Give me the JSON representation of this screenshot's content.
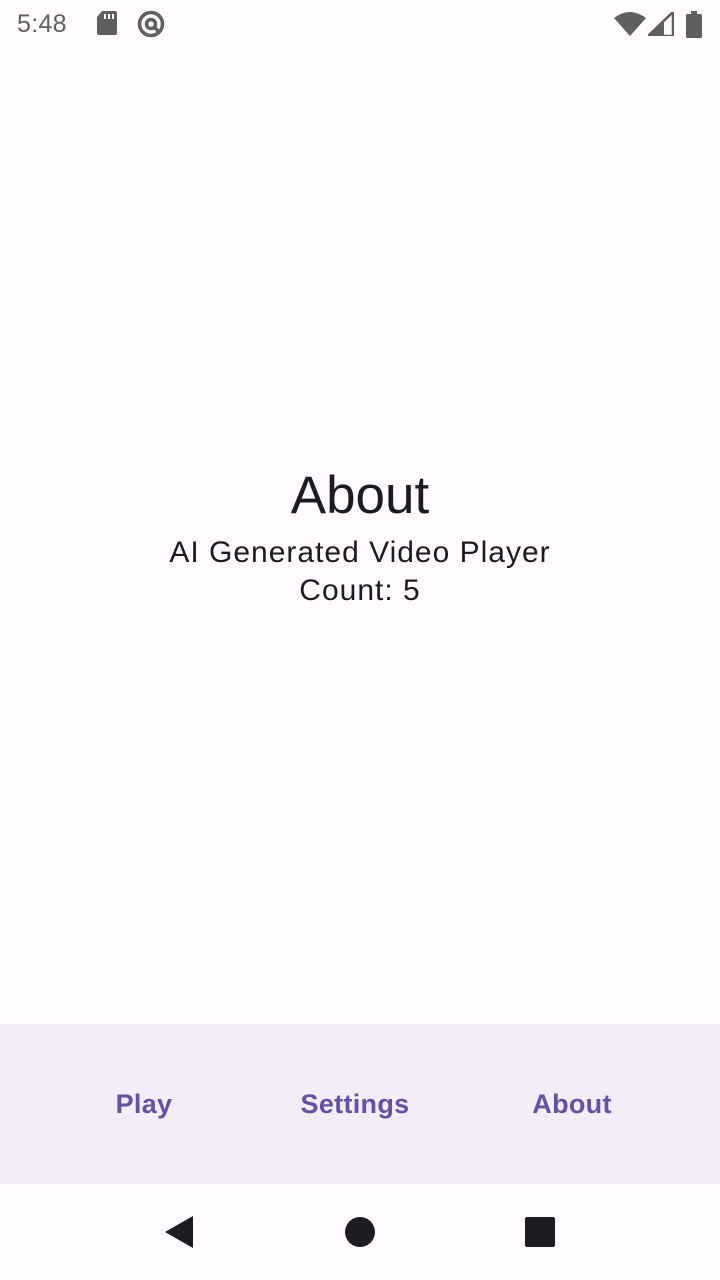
{
  "status_bar": {
    "time": "5:48",
    "left_icons": [
      "sd-card-icon",
      "at-sign-icon"
    ],
    "right_icons": [
      "wifi-icon",
      "cell-signal-icon",
      "battery-icon"
    ]
  },
  "main": {
    "title": "About",
    "subtitle": "AI Generated Video Player",
    "count": "Count: 5"
  },
  "bottom_nav": {
    "items": [
      {
        "label": "Play"
      },
      {
        "label": "Settings"
      },
      {
        "label": "About"
      }
    ],
    "accent_color": "#6750a4",
    "background_color": "#f2edf7"
  },
  "system_nav": {
    "buttons": [
      "back-icon",
      "home-icon",
      "recents-icon"
    ]
  }
}
